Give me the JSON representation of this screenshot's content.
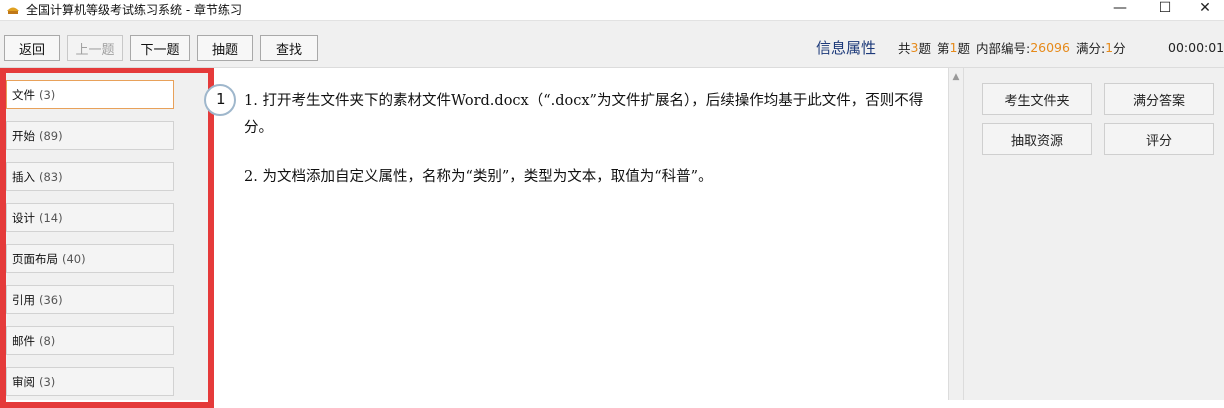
{
  "window": {
    "title": "全国计算机等级考试练习系统 - 章节练习",
    "minimize": "—",
    "maximize": "☐",
    "close": "✕"
  },
  "toolbar": {
    "back": "返回",
    "prev": "上一题",
    "next": "下一题",
    "draw": "抽题",
    "find": "查找"
  },
  "info": {
    "title": "信息属性",
    "total_prefix": "共",
    "total": "3",
    "total_suffix": "题",
    "current_prefix": "第",
    "current": "1",
    "current_suffix": "题",
    "code_label": "内部编号:",
    "code": "26096",
    "score_label": "满分:",
    "score": "1",
    "score_suffix": "分",
    "timer": "00:00:01"
  },
  "categories": [
    {
      "name": "文件",
      "count": "(3)"
    },
    {
      "name": "开始",
      "count": "(89)"
    },
    {
      "name": "插入",
      "count": "(83)"
    },
    {
      "name": "设计",
      "count": "(14)"
    },
    {
      "name": "页面布局",
      "count": "(40)"
    },
    {
      "name": "引用",
      "count": "(36)"
    },
    {
      "name": "邮件",
      "count": "(8)"
    },
    {
      "name": "审阅",
      "count": "(3)"
    }
  ],
  "question": {
    "number": "1",
    "line1": "1.    打开考生文件夹下的素材文件Word.docx（“.docx”为文件扩展名），后续操作均基于此文件，否则不得分。",
    "line2": "2.   为文档添加自定义属性，名称为“类别”，类型为文本，取值为“科普”。"
  },
  "right": {
    "folder": "考生文件夹",
    "answer": "满分答案",
    "resource": "抽取资源",
    "grade": "评分"
  },
  "colors": {
    "highlight": "#e53a3a",
    "accent": "#e68a1a",
    "title_blue": "#1d3a7a"
  }
}
